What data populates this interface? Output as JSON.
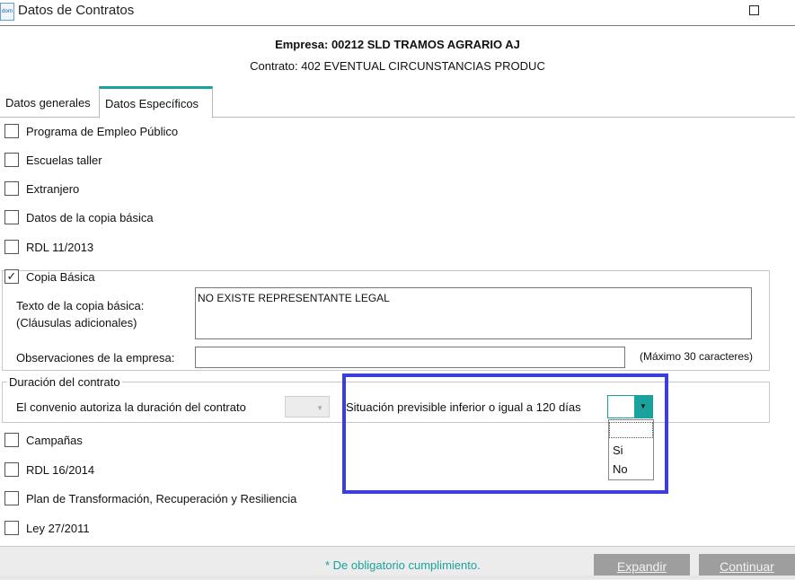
{
  "window": {
    "title": "Datos de Contratos",
    "app_icon_text": "dom"
  },
  "header": {
    "company": "Empresa: 00212 SLD TRAMOS AGRARIO AJ",
    "contract": "Contrato: 402 EVENTUAL CIRCUNSTANCIAS PRODUC"
  },
  "tabs": [
    {
      "label": "Datos generales",
      "active": false
    },
    {
      "label": "Datos Específicos",
      "active": true
    }
  ],
  "checks": {
    "programa": {
      "label": "Programa de Empleo Público",
      "checked": false
    },
    "escuelas": {
      "label": "Escuelas taller",
      "checked": false
    },
    "extranjero": {
      "label": "Extranjero",
      "checked": false
    },
    "datos_copia": {
      "label": "Datos de la copia básica",
      "checked": false
    },
    "rdl_2013": {
      "label": "RDL 11/2013",
      "checked": false
    },
    "copia_basica": {
      "label": "Copia Básica",
      "checked": true,
      "mark": "✓"
    },
    "campanas": {
      "label": "Campañas",
      "checked": false
    },
    "rdl_2014": {
      "label": "RDL 16/2014",
      "checked": false
    },
    "plan": {
      "label": "Plan de Transformación, Recuperación y Resiliencia",
      "checked": false
    },
    "ley": {
      "label": "Ley 27/2011",
      "checked": false
    }
  },
  "copia": {
    "texto_label_1": "Texto de la copia básica:",
    "texto_label_2": "(Cláusulas adicionales)",
    "texto_value": "NO EXISTE REPRESENTANTE LEGAL",
    "obs_label": "Observaciones de la empresa:",
    "obs_value": "",
    "obs_hint": "(Máximo 30 caracteres)"
  },
  "duracion": {
    "legend": "Duración del contrato",
    "convenio_label": "El convenio autoriza la duración del contrato",
    "convenio_value": "",
    "situacion_label": "Situación previsible inferior o igual a 120 días",
    "situacion_value": "",
    "options": [
      "",
      "Si",
      "No"
    ]
  },
  "footer": {
    "note": "* De obligatorio cumplimiento.",
    "expand_label": "Expandir",
    "continue_label": "Continuar"
  },
  "colors": {
    "accent": "#1aa39e",
    "highlight": "#3b3ed8",
    "button_disabled": "#9e9e9e"
  }
}
